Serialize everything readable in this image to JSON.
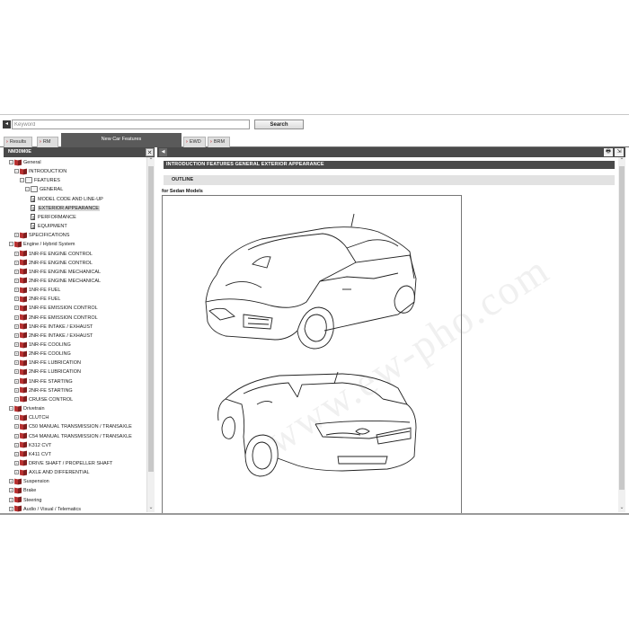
{
  "search": {
    "icon": "keyword-icon",
    "placeholder": "Keyword",
    "button_label": "Search"
  },
  "tabs": [
    {
      "label": "Results",
      "active": false
    },
    {
      "label": "RM",
      "active": false
    },
    {
      "label": "New Car Features",
      "active": true
    },
    {
      "label": "EWD",
      "active": false
    },
    {
      "label": "BRM",
      "active": false
    }
  ],
  "left_panel": {
    "title": "NM30M0E",
    "close_glyph": "✕"
  },
  "toolbar": {
    "collapse_glyph": "◀",
    "print_glyph": "🖶",
    "exit_glyph": "⇲"
  },
  "tree": [
    {
      "label": "General",
      "kind": "book",
      "expanded": true,
      "level": 0
    },
    {
      "label": "INTRODUCTION",
      "kind": "book",
      "expanded": true,
      "level": 1
    },
    {
      "label": "FEATURES",
      "kind": "openbook",
      "expanded": true,
      "level": 2
    },
    {
      "label": "GENERAL",
      "kind": "openbook",
      "expanded": true,
      "level": 3
    },
    {
      "label": "MODEL CODE AND LINE-UP",
      "kind": "doc",
      "level": 4
    },
    {
      "label": "EXTERIOR APPEARANCE",
      "kind": "doc",
      "level": 4,
      "selected": true
    },
    {
      "label": "PERFORMANCE",
      "kind": "doc",
      "level": 4
    },
    {
      "label": "EQUIPMENT",
      "kind": "doc",
      "level": 4
    },
    {
      "label": "SPECIFICATIONS",
      "kind": "book",
      "expanded": false,
      "level": 1
    },
    {
      "label": "Engine / Hybrid System",
      "kind": "book",
      "expanded": true,
      "level": 0
    },
    {
      "label": "1NR-FE ENGINE CONTROL",
      "kind": "book",
      "expanded": false,
      "level": 1
    },
    {
      "label": "2NR-FE ENGINE CONTROL",
      "kind": "book",
      "expanded": false,
      "level": 1
    },
    {
      "label": "1NR-FE ENGINE MECHANICAL",
      "kind": "book",
      "expanded": false,
      "level": 1
    },
    {
      "label": "2NR-FE ENGINE MECHANICAL",
      "kind": "book",
      "expanded": false,
      "level": 1
    },
    {
      "label": "1NR-FE FUEL",
      "kind": "book",
      "expanded": false,
      "level": 1
    },
    {
      "label": "2NR-FE FUEL",
      "kind": "book",
      "expanded": false,
      "level": 1
    },
    {
      "label": "1NR-FE EMISSION CONTROL",
      "kind": "book",
      "expanded": false,
      "level": 1
    },
    {
      "label": "2NR-FE EMISSION CONTROL",
      "kind": "book",
      "expanded": false,
      "level": 1
    },
    {
      "label": "1NR-FE INTAKE / EXHAUST",
      "kind": "book",
      "expanded": false,
      "level": 1
    },
    {
      "label": "2NR-FE INTAKE / EXHAUST",
      "kind": "book",
      "expanded": false,
      "level": 1
    },
    {
      "label": "1NR-FE COOLING",
      "kind": "book",
      "expanded": false,
      "level": 1
    },
    {
      "label": "2NR-FE COOLING",
      "kind": "book",
      "expanded": false,
      "level": 1
    },
    {
      "label": "1NR-FE LUBRICATION",
      "kind": "book",
      "expanded": false,
      "level": 1
    },
    {
      "label": "2NR-FE LUBRICATION",
      "kind": "book",
      "expanded": false,
      "level": 1
    },
    {
      "label": "1NR-FE STARTING",
      "kind": "book",
      "expanded": false,
      "level": 1
    },
    {
      "label": "2NR-FE STARTING",
      "kind": "book",
      "expanded": false,
      "level": 1
    },
    {
      "label": "CRUISE CONTROL",
      "kind": "book",
      "expanded": false,
      "level": 1
    },
    {
      "label": "Drivetrain",
      "kind": "book",
      "expanded": true,
      "level": 0
    },
    {
      "label": "CLUTCH",
      "kind": "book",
      "expanded": false,
      "level": 1
    },
    {
      "label": "C50 MANUAL TRANSMISSION / TRANSAXLE",
      "kind": "book",
      "expanded": false,
      "level": 1
    },
    {
      "label": "C54 MANUAL TRANSMISSION / TRANSAXLE",
      "kind": "book",
      "expanded": false,
      "level": 1
    },
    {
      "label": "K312 CVT",
      "kind": "book",
      "expanded": false,
      "level": 1
    },
    {
      "label": "K411 CVT",
      "kind": "book",
      "expanded": false,
      "level": 1
    },
    {
      "label": "DRIVE SHAFT / PROPELLER SHAFT",
      "kind": "book",
      "expanded": false,
      "level": 1
    },
    {
      "label": "AXLE AND DIFFERENTIAL",
      "kind": "book",
      "expanded": false,
      "level": 1
    },
    {
      "label": "Suspension",
      "kind": "book",
      "expanded": false,
      "level": 0
    },
    {
      "label": "Brake",
      "kind": "book",
      "expanded": false,
      "level": 0
    },
    {
      "label": "Steering",
      "kind": "book",
      "expanded": false,
      "level": 0
    },
    {
      "label": "Audio / Visual / Telematics",
      "kind": "book",
      "expanded": false,
      "level": 0
    }
  ],
  "content": {
    "breadcrumb": "INTRODUCTION  FEATURES  GENERAL  EXTERIOR APPEARANCE",
    "section": "OUTLINE",
    "caption": "for Sedan Models"
  },
  "watermark": "www.ew-pho.com",
  "colors": {
    "header_bg": "#4a4a4a",
    "tab_active": "#5a5a5a",
    "book_red": "#b83232"
  }
}
